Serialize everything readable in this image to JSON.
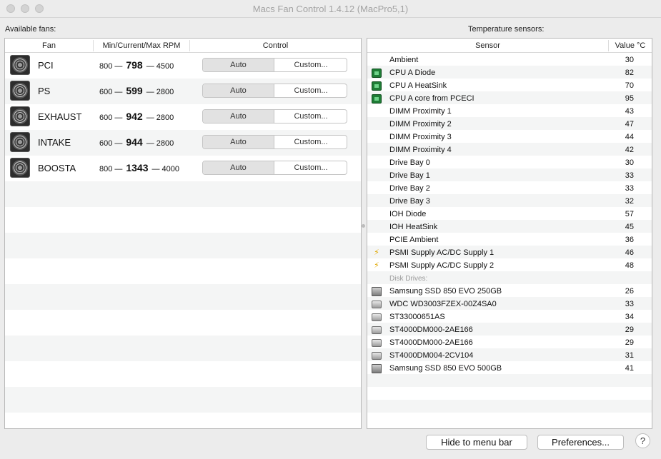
{
  "window": {
    "title": "Macs Fan Control 1.4.12 (MacPro5,1)"
  },
  "fans_panel": {
    "label": "Available fans:",
    "headers": {
      "fan": "Fan",
      "rpm": "Min/Current/Max RPM",
      "control": "Control"
    },
    "fans": [
      {
        "name": "PCI",
        "min": "800",
        "current": "798",
        "max": "4500",
        "auto": "Auto",
        "custom": "Custom..."
      },
      {
        "name": "PS",
        "min": "600",
        "current": "599",
        "max": "2800",
        "auto": "Auto",
        "custom": "Custom..."
      },
      {
        "name": "EXHAUST",
        "min": "600",
        "current": "942",
        "max": "2800",
        "auto": "Auto",
        "custom": "Custom..."
      },
      {
        "name": "INTAKE",
        "min": "600",
        "current": "944",
        "max": "2800",
        "auto": "Auto",
        "custom": "Custom..."
      },
      {
        "name": "BOOSTA",
        "min": "800",
        "current": "1343",
        "max": "4000",
        "auto": "Auto",
        "custom": "Custom..."
      }
    ]
  },
  "sensors_panel": {
    "label": "Temperature sensors:",
    "headers": {
      "sensor": "Sensor",
      "value": "Value °C"
    },
    "sensors": [
      {
        "name": "Ambient",
        "value": "30",
        "icon": "none"
      },
      {
        "name": "CPU A Diode",
        "value": "82",
        "icon": "chip-icon"
      },
      {
        "name": "CPU A HeatSink",
        "value": "70",
        "icon": "chip-icon"
      },
      {
        "name": "CPU A core from PCECI",
        "value": "95",
        "icon": "chip-icon"
      },
      {
        "name": "DIMM Proximity 1",
        "value": "43",
        "icon": "none"
      },
      {
        "name": "DIMM Proximity 2",
        "value": "47",
        "icon": "none"
      },
      {
        "name": "DIMM Proximity 3",
        "value": "44",
        "icon": "none"
      },
      {
        "name": "DIMM Proximity 4",
        "value": "42",
        "icon": "none"
      },
      {
        "name": "Drive Bay 0",
        "value": "30",
        "icon": "none"
      },
      {
        "name": "Drive Bay 1",
        "value": "33",
        "icon": "none"
      },
      {
        "name": "Drive Bay 2",
        "value": "33",
        "icon": "none"
      },
      {
        "name": "Drive Bay 3",
        "value": "32",
        "icon": "none"
      },
      {
        "name": "IOH Diode",
        "value": "57",
        "icon": "none"
      },
      {
        "name": "IOH HeatSink",
        "value": "45",
        "icon": "none"
      },
      {
        "name": "PCIE Ambient",
        "value": "36",
        "icon": "none"
      },
      {
        "name": "PSMI Supply AC/DC Supply 1",
        "value": "46",
        "icon": "bolt-icon"
      },
      {
        "name": "PSMI Supply AC/DC Supply 2",
        "value": "48",
        "icon": "bolt-icon"
      }
    ],
    "disk_group_label": "Disk Drives:",
    "disks": [
      {
        "name": "Samsung SSD 850 EVO 250GB",
        "value": "26",
        "icon": "ssd-icon"
      },
      {
        "name": "WDC WD3003FZEX-00Z4SA0",
        "value": "33",
        "icon": "hard-drive-icon"
      },
      {
        "name": "ST33000651AS",
        "value": "34",
        "icon": "hard-drive-icon"
      },
      {
        "name": "ST4000DM000-2AE166",
        "value": "29",
        "icon": "hard-drive-icon"
      },
      {
        "name": "ST4000DM000-2AE166",
        "value": "29",
        "icon": "hard-drive-icon"
      },
      {
        "name": "ST4000DM004-2CV104",
        "value": "31",
        "icon": "hard-drive-icon"
      },
      {
        "name": "Samsung SSD 850 EVO 500GB",
        "value": "41",
        "icon": "ssd-icon"
      }
    ]
  },
  "footer": {
    "hide_label": "Hide to menu bar",
    "preferences_label": "Preferences...",
    "help_label": "?"
  },
  "colors": {
    "stripe": "#f4f5f5",
    "chip": "#1e7c35",
    "bolt": "#e0a800"
  }
}
